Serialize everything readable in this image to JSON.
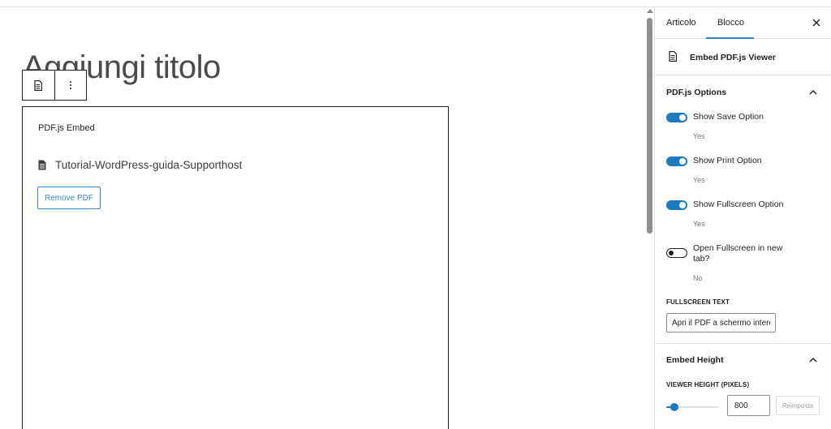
{
  "editor": {
    "title_placeholder": "Aggiungi titolo",
    "block": {
      "label": "PDF.js Embed",
      "file_name": "Tutorial-WordPress-guida-Supporthost",
      "remove_button": "Remove PDF"
    },
    "toolbar": {
      "block_type_icon": "document-icon",
      "more_options_icon": "more-vertical-icon"
    }
  },
  "sidebar": {
    "tabs": [
      {
        "label": "Articolo",
        "active": false
      },
      {
        "label": "Blocco",
        "active": true
      }
    ],
    "close_icon": "close-icon",
    "block_card": {
      "title": "Embed PDF.js Viewer",
      "icon": "document-icon"
    },
    "panels": {
      "options": {
        "title": "PDF.js Options",
        "toggles": [
          {
            "label": "Show Save Option",
            "help": "Yes",
            "checked": true
          },
          {
            "label": "Show Print Option",
            "help": "Yes",
            "checked": true
          },
          {
            "label": "Show Fullscreen Option",
            "help": "Yes",
            "checked": true
          },
          {
            "label": "Open Fullscreen in new tab?",
            "help": "No",
            "checked": false
          }
        ],
        "fullscreen_text_label": "FULLSCREEN TEXT",
        "fullscreen_text_value": "Apri il PDF a schermo intero"
      },
      "height": {
        "title": "Embed Height",
        "viewer_height_label": "VIEWER HEIGHT (PIXELS)",
        "viewer_height_value": "800",
        "slider_fraction": 0.15,
        "reset_label": "Reimposta"
      }
    }
  },
  "colors": {
    "accent": "#1b7ac2",
    "button_outline": "#3582c4",
    "border": "#e0e0e0"
  }
}
